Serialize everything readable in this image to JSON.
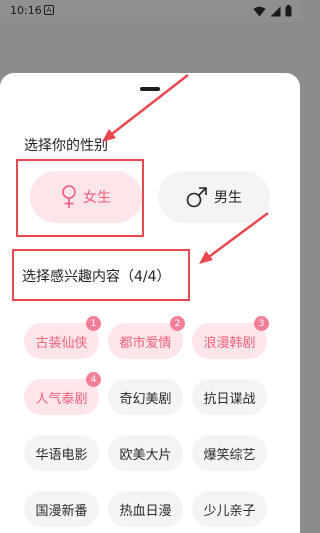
{
  "status_bar": {
    "time": "10:16",
    "notif_glyph": "A"
  },
  "gender": {
    "title": "选择你的性别",
    "female_label": "女生",
    "male_label": "男生"
  },
  "interests": {
    "title": "选择感兴趣内容（4/4）",
    "tags": [
      {
        "label": "古装仙侠",
        "selected": true,
        "badge": "1"
      },
      {
        "label": "都市爱情",
        "selected": true,
        "badge": "2"
      },
      {
        "label": "浪漫韩剧",
        "selected": true,
        "badge": "3"
      },
      {
        "label": "人气泰剧",
        "selected": true,
        "badge": "4"
      },
      {
        "label": "奇幻美剧",
        "selected": false,
        "badge": ""
      },
      {
        "label": "抗日谍战",
        "selected": false,
        "badge": ""
      },
      {
        "label": "华语电影",
        "selected": false,
        "badge": ""
      },
      {
        "label": "欧美大片",
        "selected": false,
        "badge": ""
      },
      {
        "label": "爆笑综艺",
        "selected": false,
        "badge": ""
      },
      {
        "label": "国漫新番",
        "selected": false,
        "badge": ""
      },
      {
        "label": "热血日漫",
        "selected": false,
        "badge": ""
      },
      {
        "label": "少儿亲子",
        "selected": false,
        "badge": ""
      }
    ]
  },
  "colors": {
    "accent_pink": "#f05a7e",
    "selected_bg": "#fde5ea",
    "annotation_red": "#e8474f"
  }
}
